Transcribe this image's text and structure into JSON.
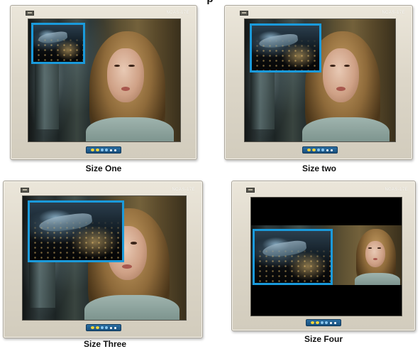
{
  "header": {
    "title": "p"
  },
  "panels": [
    {
      "caption": "Size One",
      "model_text": "NCAS-17E",
      "pip_mode": "small"
    },
    {
      "caption": "Size two",
      "model_text": "NCAS-17E",
      "pip_mode": "medium"
    },
    {
      "caption": "Size Three",
      "model_text": "NCAS-17E",
      "pip_mode": "large"
    },
    {
      "caption": "Size Four",
      "model_text": "NCAS-17E",
      "pip_mode": "letterbox"
    }
  ],
  "colors": {
    "pip_border": "#1a9adb",
    "bezel": "#ddd7c9",
    "control_strip": "#1e5f92",
    "control_buttons": "#f2d43a"
  },
  "icons": {
    "control_strip": "front-panel-osd-buttons",
    "badge": "brand-badge"
  }
}
